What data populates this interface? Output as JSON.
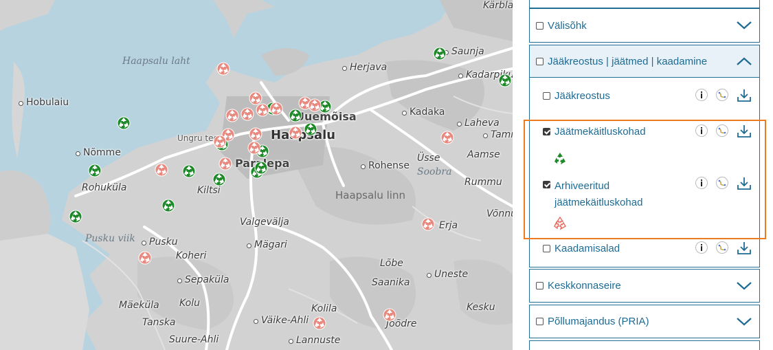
{
  "map": {
    "places": [
      {
        "name": "Kärbla",
        "cls": "italic"
      },
      {
        "name": "Saunja",
        "cls": "italic"
      },
      {
        "name": "Haapsalu laht",
        "cls": "water"
      },
      {
        "name": "Herjava",
        "cls": "italic"
      },
      {
        "name": "Kadarpiku",
        "cls": "italic"
      },
      {
        "name": "Hobulaiu",
        "cls": ""
      },
      {
        "name": "Uuemõisa",
        "cls": "mid"
      },
      {
        "name": "Kadaka",
        "cls": ""
      },
      {
        "name": "Laheva",
        "cls": "italic"
      },
      {
        "name": "Tammiku",
        "cls": "italic"
      },
      {
        "name": "Haapsalu",
        "cls": "big"
      },
      {
        "name": "Ungru tee",
        "cls": "road"
      },
      {
        "name": "Nõmme",
        "cls": ""
      },
      {
        "name": "Paralepa",
        "cls": "mid"
      },
      {
        "name": "Rohense",
        "cls": ""
      },
      {
        "name": "Üsse",
        "cls": "italic"
      },
      {
        "name": "Soobra",
        "cls": "water"
      },
      {
        "name": "Aamse",
        "cls": "italic"
      },
      {
        "name": "Rummu",
        "cls": "italic"
      },
      {
        "name": "Rohuküla",
        "cls": "italic"
      },
      {
        "name": "Kiltsi",
        "cls": "italic"
      },
      {
        "name": "Haapsalu linn",
        "cls": "region"
      },
      {
        "name": "Võnnu",
        "cls": "italic"
      },
      {
        "name": "Valgevälja",
        "cls": "italic"
      },
      {
        "name": "Erja",
        "cls": "italic"
      },
      {
        "name": "Pusku viik",
        "cls": "water"
      },
      {
        "name": "Pusku",
        "cls": "italic"
      },
      {
        "name": "Mägari",
        "cls": "italic"
      },
      {
        "name": "Koheri",
        "cls": "italic"
      },
      {
        "name": "Lõbe",
        "cls": "italic"
      },
      {
        "name": "Uneste",
        "cls": "italic"
      },
      {
        "name": "Sepaküla",
        "cls": "italic"
      },
      {
        "name": "Saanika",
        "cls": "italic"
      },
      {
        "name": "Mäeküla",
        "cls": "italic"
      },
      {
        "name": "Kolu",
        "cls": "italic"
      },
      {
        "name": "Kolila",
        "cls": "italic"
      },
      {
        "name": "Kesku",
        "cls": "italic"
      },
      {
        "name": "Tanska",
        "cls": "italic"
      },
      {
        "name": "Väike-Ahli",
        "cls": "italic"
      },
      {
        "name": "Jõõdre",
        "cls": "italic"
      },
      {
        "name": "Suure-Ahli",
        "cls": "italic"
      },
      {
        "name": "Lannuste",
        "cls": "italic"
      }
    ]
  },
  "panel": {
    "groups": [
      {
        "label": "Välisõhk",
        "checked": false,
        "expanded": false
      },
      {
        "label": "Jääkreostus | jäätmed | kaadamine",
        "checked": false,
        "expanded": true
      },
      {
        "label": "Keskkonnaseire",
        "checked": false,
        "expanded": false
      },
      {
        "label": "Põllumajandus (PRIA)",
        "checked": false,
        "expanded": false
      }
    ],
    "layers": [
      {
        "label": "Jääkreostus",
        "checked": false
      },
      {
        "label": "Jäätmekäitluskohad",
        "checked": true
      },
      {
        "label": "Arhiveeritud jäätmekäitluskohad",
        "checked": true
      },
      {
        "label": "Kaadamisalad",
        "checked": false
      }
    ],
    "colors": {
      "accent": "#1d6b94",
      "highlight": "#ec7a1e",
      "active_marker": "#1f8a2a",
      "archived_marker": "#e98a80"
    },
    "icons": [
      "info-icon",
      "legend-icon",
      "download-icon",
      "recycle-icon",
      "chevron-down-icon",
      "chevron-up-icon"
    ]
  }
}
